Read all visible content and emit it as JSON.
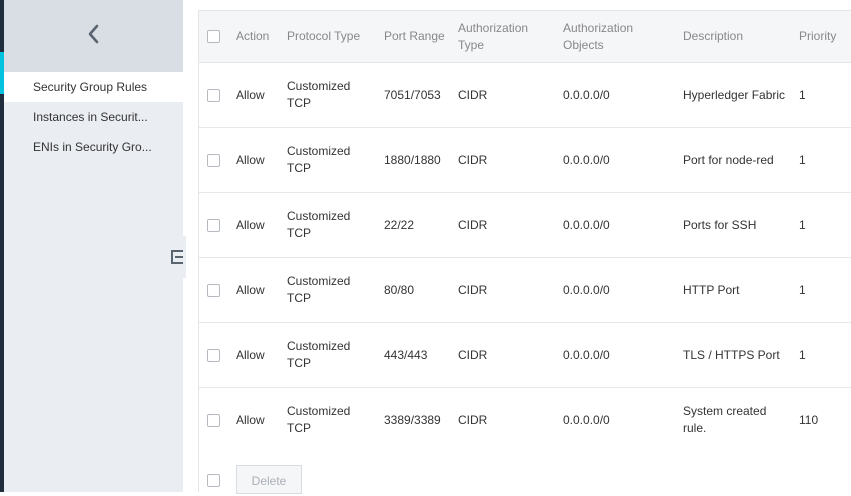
{
  "sidebar": {
    "back_icon": "chevron-left-icon",
    "items": [
      {
        "label": "Security Group Rules",
        "active": true
      },
      {
        "label": "Instances in Securit...",
        "active": false
      },
      {
        "label": "ENIs in Security Gro...",
        "active": false
      }
    ]
  },
  "table": {
    "headers": {
      "action": "Action",
      "protocol": "Protocol Type",
      "port_range": "Port Range",
      "auth_type": "Authorization Type",
      "auth_objects": "Authorization Objects",
      "description": "Description",
      "priority": "Priority"
    },
    "rows": [
      {
        "action": "Allow",
        "protocol": "Customized TCP",
        "port_range": "7051/7053",
        "auth_type": "CIDR",
        "auth_objects": "0.0.0.0/0",
        "description": "Hyperledger Fabric",
        "priority": "1"
      },
      {
        "action": "Allow",
        "protocol": "Customized TCP",
        "port_range": "1880/1880",
        "auth_type": "CIDR",
        "auth_objects": "0.0.0.0/0",
        "description": "Port for node-red",
        "priority": "1"
      },
      {
        "action": "Allow",
        "protocol": "Customized TCP",
        "port_range": "22/22",
        "auth_type": "CIDR",
        "auth_objects": "0.0.0.0/0",
        "description": "Ports for SSH",
        "priority": "1"
      },
      {
        "action": "Allow",
        "protocol": "Customized TCP",
        "port_range": "80/80",
        "auth_type": "CIDR",
        "auth_objects": "0.0.0.0/0",
        "description": "HTTP Port",
        "priority": "1"
      },
      {
        "action": "Allow",
        "protocol": "Customized TCP",
        "port_range": "443/443",
        "auth_type": "CIDR",
        "auth_objects": "0.0.0.0/0",
        "description": "TLS / HTTPS Port",
        "priority": "1"
      },
      {
        "action": "Allow",
        "protocol": "Customized TCP",
        "port_range": "3389/3389",
        "auth_type": "CIDR",
        "auth_objects": "0.0.0.0/0",
        "description": "System created rule.",
        "priority": "110"
      }
    ]
  },
  "footer": {
    "delete_label": "Delete"
  },
  "colors": {
    "accent": "#00c1de",
    "edge": "#1f2d3d",
    "sidebar_bg": "#eaedf1",
    "header_bg": "#f5f6f8"
  }
}
